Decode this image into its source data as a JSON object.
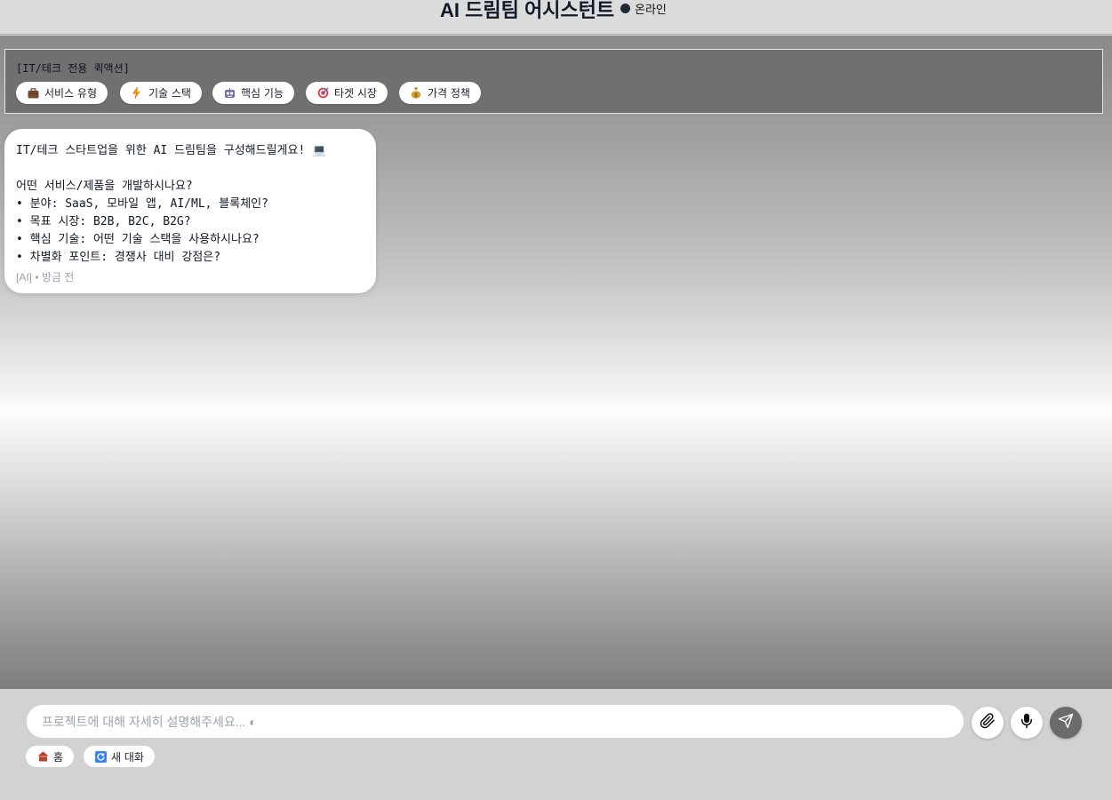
{
  "header": {
    "title": "AI 드림팀 어시스턴트",
    "status_label": "온라인"
  },
  "quick_actions": {
    "title": "[IT/테크 전용 퀵액션]",
    "items": [
      {
        "label": "서비스 유형",
        "icon": "briefcase-icon"
      },
      {
        "label": "기술 스택",
        "icon": "lightning-icon"
      },
      {
        "label": "핵심 기능",
        "icon": "robot-icon"
      },
      {
        "label": "타겟 시장",
        "icon": "target-icon"
      },
      {
        "label": "가격 정책",
        "icon": "money-bag-icon"
      }
    ]
  },
  "messages": [
    {
      "lines": [
        "IT/테크 스타트업을 위한 AI 드림팀을 구성해드릴게요! 💻",
        "",
        "어떤 서비스/제품을 개발하시나요?",
        "• 분야: SaaS, 모바일 앱, AI/ML, 블록체인?",
        "• 목표 시장: B2B, B2C, B2G?",
        "• 핵심 기술: 어떤 기술 스택을 사용하시나요?",
        "• 차별화 포인트: 경쟁사 대비 강점은?"
      ],
      "meta": "[AI] • 방금 전"
    }
  ],
  "composer": {
    "placeholder": "프로젝트에 대해 자세히 설명해주세요... ◐",
    "attach_icon": "paperclip-icon",
    "mic_icon": "microphone-icon",
    "send_icon": "send-icon"
  },
  "footer": {
    "home_label": "홈",
    "home_icon": "house-icon",
    "new_chat_label": "새 대화",
    "new_chat_icon": "refresh-icon"
  },
  "colors": {
    "chip_bg": "#ffffff",
    "panel_bg": "#707070",
    "send_button": "#6b6b6b",
    "status_dot": "#1f2937"
  }
}
